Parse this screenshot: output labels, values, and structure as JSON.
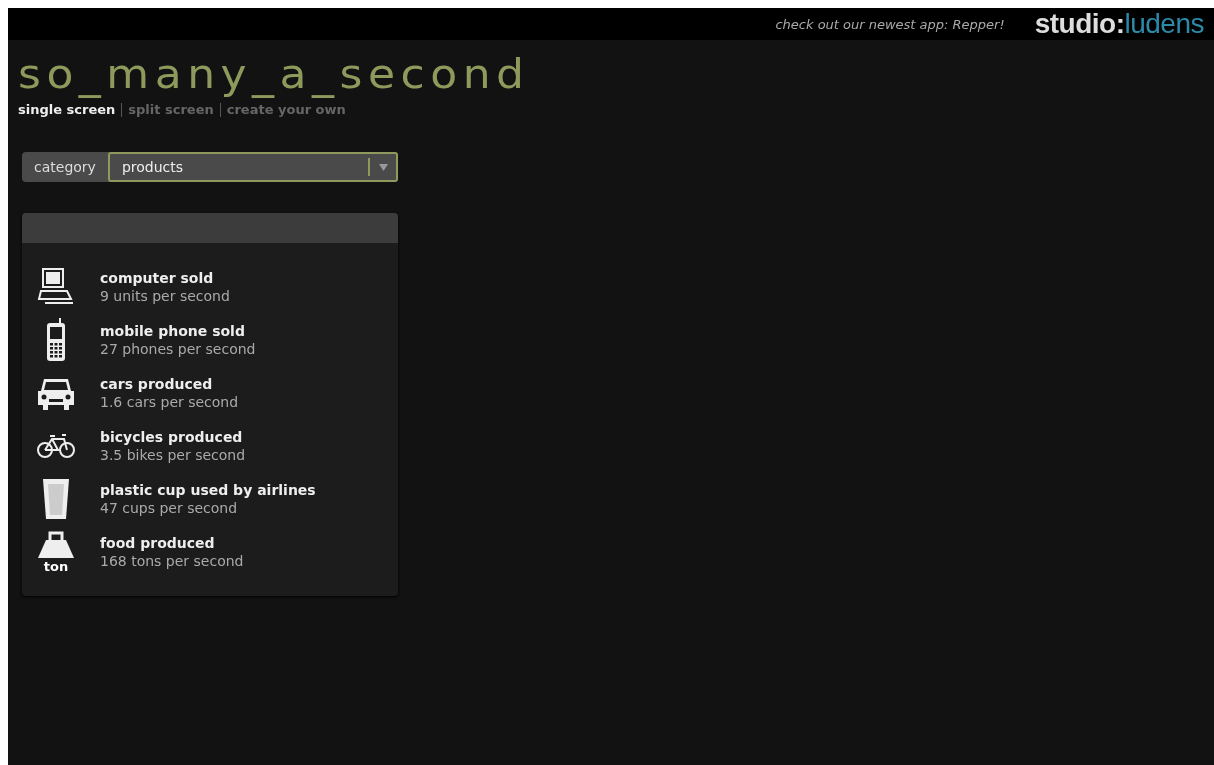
{
  "top_bar": {
    "promo": "check out our newest app: Repper!",
    "logo": {
      "first": "studio:",
      "second": "ludens"
    }
  },
  "title": "so_many_a_second",
  "nav": [
    {
      "label": "single screen",
      "selected": true
    },
    {
      "label": "split screen",
      "selected": false
    },
    {
      "label": "create your own",
      "selected": false
    }
  ],
  "category": {
    "label": "category",
    "value": "products"
  },
  "items": [
    {
      "kind": "computer",
      "title": "computer sold",
      "rate": "9 units per second"
    },
    {
      "kind": "phone",
      "title": "mobile phone sold",
      "rate": "27 phones per second"
    },
    {
      "kind": "car",
      "title": "cars produced",
      "rate": "1.6 cars per second"
    },
    {
      "kind": "bicycle",
      "title": "bicycles produced",
      "rate": "3.5 bikes per second"
    },
    {
      "kind": "cup",
      "title": "plastic cup used by airlines",
      "rate": "47 cups per second"
    },
    {
      "kind": "weight",
      "title": "food produced",
      "rate": "168 tons per second",
      "icon_text": "ton"
    }
  ]
}
